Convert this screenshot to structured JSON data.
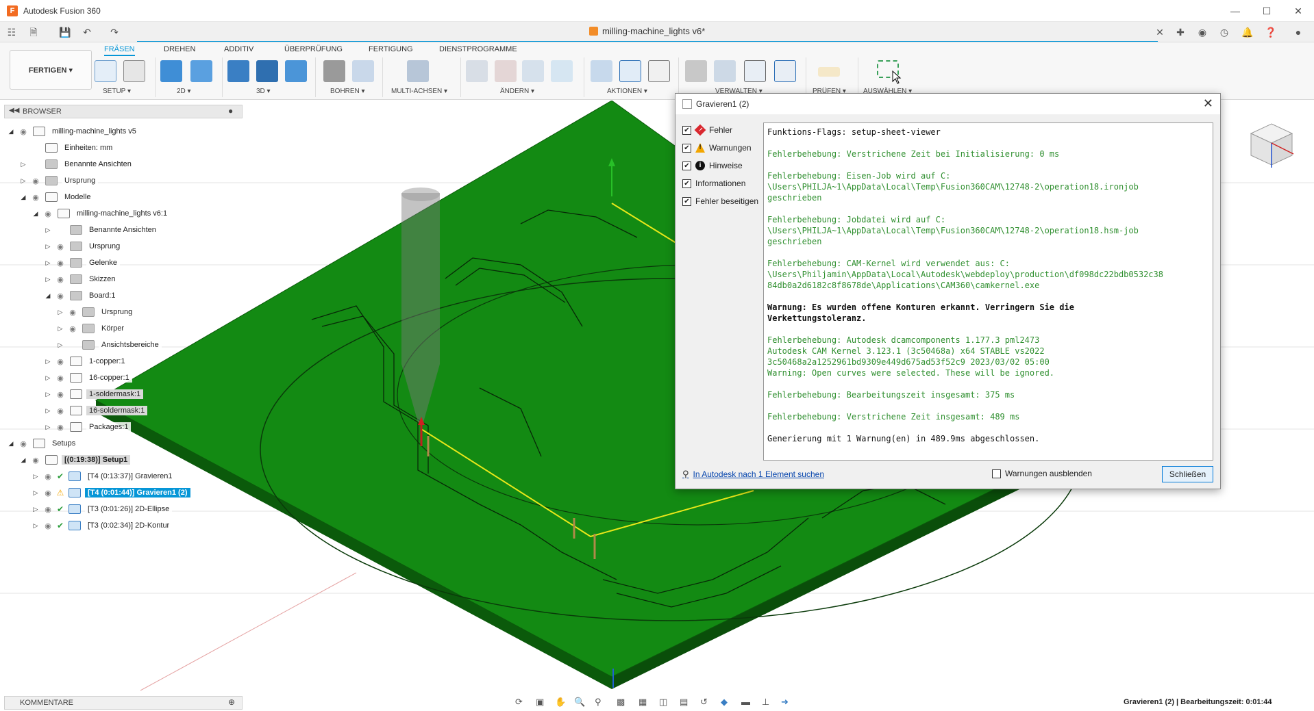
{
  "app": {
    "title": "Autodesk Fusion 360",
    "document_title": "milling-machine_lights v6*"
  },
  "ribbon": {
    "workspace": "FERTIGEN ▾",
    "tabs": [
      "FRÄSEN",
      "DREHEN",
      "ADDITIV",
      "ÜBERPRÜFUNG",
      "FERTIGUNG",
      "DIENSTPROGRAMME"
    ],
    "active_tab": "FRÄSEN",
    "groups": [
      "SETUP ▾",
      "2D ▾",
      "3D ▾",
      "BOHREN ▾",
      "MULTI-ACHSEN ▾",
      "ÄNDERN ▾",
      "AKTIONEN ▾",
      "VERWALTEN ▾",
      "PRÜFEN ▾",
      "AUSWÄHLEN ▾"
    ]
  },
  "browser": {
    "header": "BROWSER",
    "items": [
      {
        "label": "milling-machine_lights v5",
        "depth": 0,
        "arrow": "◢",
        "eye": true,
        "type": "comp"
      },
      {
        "label": "Einheiten: mm",
        "depth": 1,
        "arrow": "",
        "eye": false,
        "type": "doc"
      },
      {
        "label": "Benannte Ansichten",
        "depth": 1,
        "arrow": "▷",
        "eye": false,
        "type": "folder"
      },
      {
        "label": "Ursprung",
        "depth": 1,
        "arrow": "▷",
        "eye": true,
        "type": "folder"
      },
      {
        "label": "Modelle",
        "depth": 1,
        "arrow": "◢",
        "eye": true,
        "type": "comp"
      },
      {
        "label": "milling-machine_lights v6:1",
        "depth": 2,
        "arrow": "◢",
        "eye": true,
        "type": "comp"
      },
      {
        "label": "Benannte Ansichten",
        "depth": 3,
        "arrow": "▷",
        "eye": false,
        "type": "folder"
      },
      {
        "label": "Ursprung",
        "depth": 3,
        "arrow": "▷",
        "eye": true,
        "type": "folder"
      },
      {
        "label": "Gelenke",
        "depth": 3,
        "arrow": "▷",
        "eye": true,
        "type": "folder"
      },
      {
        "label": "Skizzen",
        "depth": 3,
        "arrow": "▷",
        "eye": true,
        "type": "folder"
      },
      {
        "label": "Board:1",
        "depth": 3,
        "arrow": "◢",
        "eye": true,
        "type": "folder"
      },
      {
        "label": "Ursprung",
        "depth": 4,
        "arrow": "▷",
        "eye": true,
        "type": "folder"
      },
      {
        "label": "Körper",
        "depth": 4,
        "arrow": "▷",
        "eye": true,
        "type": "folder"
      },
      {
        "label": "Ansichtsbereiche",
        "depth": 4,
        "arrow": "▷",
        "eye": false,
        "type": "folder"
      },
      {
        "label": "1-copper:1",
        "depth": 3,
        "arrow": "▷",
        "eye": true,
        "type": "comp"
      },
      {
        "label": "16-copper:1",
        "depth": 3,
        "arrow": "▷",
        "eye": true,
        "type": "comp"
      },
      {
        "label": "1-soldermask:1",
        "depth": 3,
        "arrow": "▷",
        "eye": true,
        "type": "comp",
        "dark": true
      },
      {
        "label": "16-soldermask:1",
        "depth": 3,
        "arrow": "▷",
        "eye": true,
        "type": "comp",
        "dark": true
      },
      {
        "label": "Packages:1",
        "depth": 3,
        "arrow": "▷",
        "eye": true,
        "type": "comp"
      },
      {
        "label": "Setups",
        "depth": 0,
        "arrow": "◢",
        "eye": true,
        "type": "setup"
      },
      {
        "label": "[(0:19:38)] Setup1",
        "depth": 1,
        "arrow": "◢",
        "eye": true,
        "type": "setup",
        "dark": true,
        "bold": true
      },
      {
        "label": "[T4 (0:13:37)] Gravieren1",
        "depth": 2,
        "arrow": "▷",
        "eye": true,
        "type": "op",
        "status": "ok"
      },
      {
        "label": "[T4 (0:01:44)] Gravieren1 (2)",
        "depth": 2,
        "arrow": "▷",
        "eye": true,
        "type": "op",
        "status": "warn",
        "selected": true
      },
      {
        "label": "[T3 (0:01:26)] 2D-Ellipse",
        "depth": 2,
        "arrow": "▷",
        "eye": true,
        "type": "op",
        "status": "ok"
      },
      {
        "label": "[T3 (0:02:34)] 2D-Kontur",
        "depth": 2,
        "arrow": "▷",
        "eye": true,
        "type": "op",
        "status": "ok"
      }
    ]
  },
  "comments": {
    "header": "KOMMENTARE"
  },
  "status": {
    "text": "Gravieren1 (2) | Bearbeitungszeit: 0:01:44"
  },
  "dialog": {
    "title": "Gravieren1 (2)",
    "filters": [
      {
        "label": "Fehler",
        "checked": true,
        "icon": "error-icon",
        "color": "#d9282f"
      },
      {
        "label": "Warnungen",
        "checked": true,
        "icon": "warning-icon",
        "color": "#f3a600"
      },
      {
        "label": "Hinweise",
        "checked": true,
        "icon": "info-icon",
        "color": "#111111"
      },
      {
        "label": "Informationen",
        "checked": true,
        "icon": "",
        "color": ""
      },
      {
        "label": "Fehler beseitigen",
        "checked": true,
        "icon": "",
        "color": ""
      }
    ],
    "log": [
      {
        "text": "Funktions-Flags: setup-sheet-viewer",
        "style": "b"
      },
      {
        "text": "Fehlerbehebung: Verstrichene Zeit bei Initialisierung: 0 ms",
        "style": "g"
      },
      {
        "text": "Fehlerbehebung: Eisen-Job wird auf C:\n\\Users\\PHILJA~1\\AppData\\Local\\Temp\\Fusion360CAM\\12748-2\\operation18.ironjob\ngeschrieben",
        "style": "g"
      },
      {
        "text": "Fehlerbehebung: Jobdatei wird auf C:\n\\Users\\PHILJA~1\\AppData\\Local\\Temp\\Fusion360CAM\\12748-2\\operation18.hsm-job\ngeschrieben",
        "style": "g"
      },
      {
        "text": "Fehlerbehebung: CAM-Kernel wird verwendet aus: C:\n\\Users\\Philjamin\\AppData\\Local\\Autodesk\\webdeploy\\production\\df098dc22bdb0532c38\n84db0a2d6182c8f8678de\\Applications\\CAM360\\camkernel.exe",
        "style": "g"
      },
      {
        "text": "Warnung: Es wurden offene Konturen erkannt. Verringern Sie die\nVerkettungstoleranz.",
        "style": "w"
      },
      {
        "text": "Fehlerbehebung: Autodesk dcamcomponents 1.177.3 pml2473\nAutodesk CAM Kernel 3.123.1 (3c50468a) x64 STABLE vs2022\n3c50468a2a1252961bd9309e449d675ad53f52c9 2023/03/02 05:00\nWarning: Open curves were selected. These will be ignored.",
        "style": "g"
      },
      {
        "text": "Fehlerbehebung: Bearbeitungszeit insgesamt: 375 ms",
        "style": "g"
      },
      {
        "text": "Fehlerbehebung: Verstrichene Zeit insgesamt: 489 ms",
        "style": "g"
      },
      {
        "text": "Generierung mit 1 Warnung(en) in 489.9ms abgeschlossen.",
        "style": "b"
      }
    ],
    "search_link": "In Autodesk nach 1 Element suchen",
    "hide_warnings": "Warnungen ausblenden",
    "close_button": "Schließen"
  },
  "colors": {
    "accent": "#0696d7",
    "board": "#138a13",
    "board_side": "#0b5a0b",
    "toolpath": "#e8e81a"
  }
}
